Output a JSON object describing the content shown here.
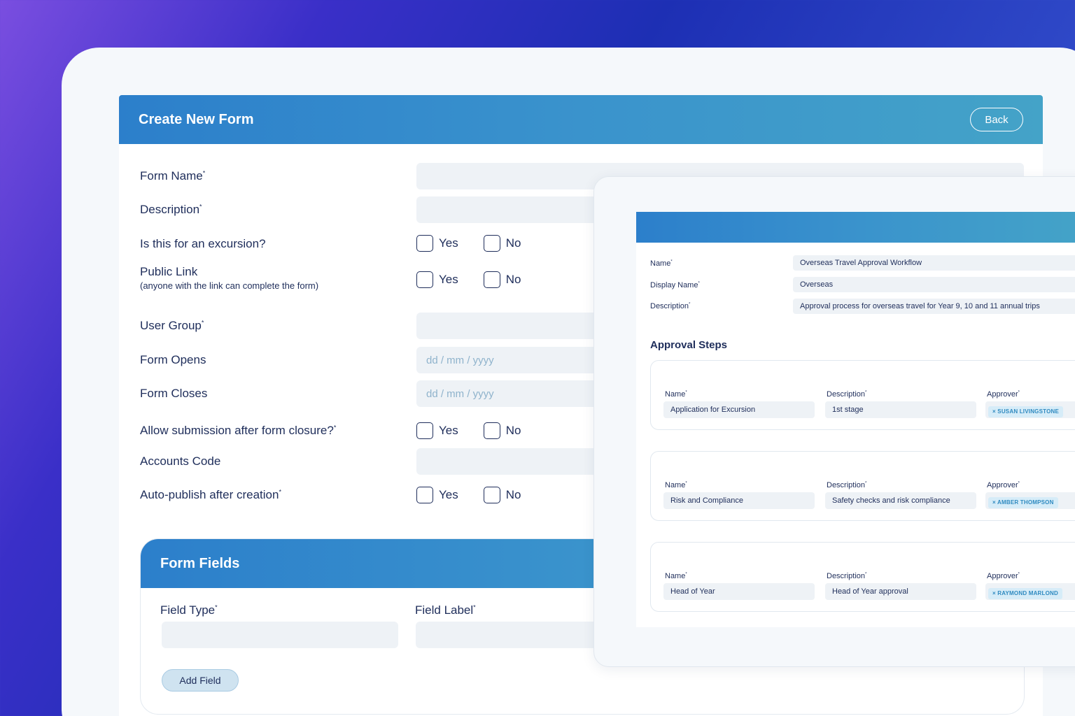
{
  "form": {
    "title": "Create New Form",
    "back_label": "Back",
    "rows": {
      "form_name": "Form Name",
      "description": "Description",
      "excursion": "Is this for an excursion?",
      "public_link": "Public Link",
      "public_link_note": "(anyone with the link can complete the form)",
      "user_group": "User Group",
      "form_opens": "Form Opens",
      "form_closes": "Form Closes",
      "allow_submission": "Allow submission after form closure?",
      "accounts_code": "Accounts Code",
      "auto_publish": "Auto-publish after creation"
    },
    "required_mark": "*",
    "yes_label": "Yes",
    "no_label": "No",
    "date_placeholder": "dd / mm / yyyy"
  },
  "form_fields": {
    "title": "Form Fields",
    "field_type_label": "Field Type",
    "field_label_label": "Field Label",
    "add_field_label": "Add Field"
  },
  "workflow": {
    "name_label": "Name",
    "name_value": "Overseas Travel Approval Workflow",
    "display_name_label": "Display Name",
    "display_name_value": "Overseas",
    "description_label": "Description",
    "description_value": "Approval process for overseas travel for Year 9, 10 and 11 annual trips",
    "steps_title": "Approval Steps",
    "step_name_label": "Name",
    "step_description_label": "Description",
    "step_approver_label": "Approver",
    "steps": [
      {
        "name": "Application for Excursion",
        "description": "1st stage",
        "approver": "× SUSAN LIVINGSTONE"
      },
      {
        "name": "Risk and Compliance",
        "description": "Safety checks and risk compliance",
        "approver": "× AMBER THOMPSON"
      },
      {
        "name": "Head of Year",
        "description": "Head of Year approval",
        "approver": "× RAYMOND MARLOND"
      }
    ]
  },
  "colors": {
    "header_gradient_start": "#2c7fcb",
    "header_gradient_end": "#44a3c8",
    "text_primary": "#1e2d5a",
    "input_bg": "#eef2f6",
    "chip_text": "#2f8ac0"
  }
}
